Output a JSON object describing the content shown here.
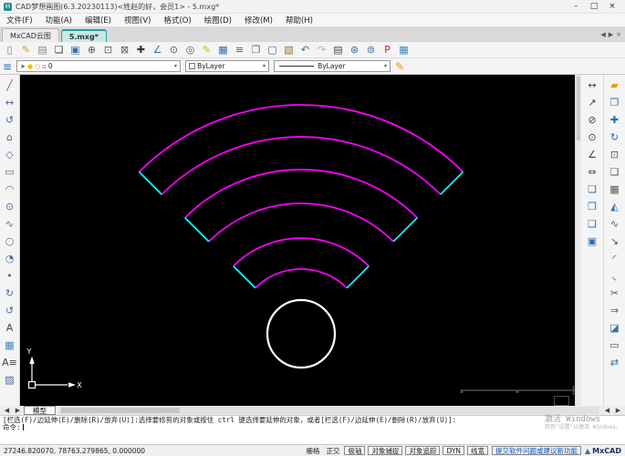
{
  "window": {
    "title": "CAD梦想画图(6.3.20230113)<姓赵的好，会员1> - 5.mxg*",
    "controls": {
      "minimize": "–",
      "maximize": "□",
      "close": "×"
    }
  },
  "menu": {
    "items": [
      "文件(F)",
      "功能(A)",
      "编辑(E)",
      "视图(V)",
      "格式(O)",
      "绘图(D)",
      "修改(M)",
      "帮助(H)"
    ]
  },
  "doc_tabs": {
    "items": [
      {
        "label": "MxCAD云图",
        "name": "tab-mxcad-cloud",
        "active": false
      },
      {
        "label": "5.mxg*",
        "name": "tab-5mxg",
        "active": true
      }
    ],
    "scroll_left": "◀",
    "scroll_right": "▶",
    "close": "×"
  },
  "toolbar_main": {
    "icons": [
      {
        "name": "new-file-icon",
        "glyph": "▯",
        "color": "#7a7a7a"
      },
      {
        "name": "sketch-edit-icon",
        "glyph": "✎",
        "color": "#e09a00"
      },
      {
        "name": "save-sketch-icon",
        "glyph": "▤",
        "color": "#8a8a8a"
      },
      {
        "name": "open-file-icon",
        "glyph": "❏",
        "color": "#4a3b2a"
      },
      {
        "name": "save-file-icon",
        "glyph": "▣",
        "color": "#3a6ea5"
      },
      {
        "name": "zoom-dynamic-icon",
        "glyph": "⊕",
        "color": "#5a5a5a"
      },
      {
        "name": "zoom-window-icon",
        "glyph": "⊡",
        "color": "#5a5a5a"
      },
      {
        "name": "zoom-extents-icon",
        "glyph": "⊠",
        "color": "#5a5a5a"
      },
      {
        "name": "pan-icon",
        "glyph": "✚",
        "color": "#333333"
      },
      {
        "name": "line-angle-icon",
        "glyph": "∠",
        "color": "#3a6ea5"
      },
      {
        "name": "zoom-center-icon",
        "glyph": "⊙",
        "color": "#5a5a5a"
      },
      {
        "name": "find-icon",
        "glyph": "◎",
        "color": "#5a5a5a"
      },
      {
        "name": "draw-pencil-icon",
        "glyph": "✎",
        "color": "#d4b400"
      },
      {
        "name": "color-table-icon",
        "glyph": "▦",
        "color": "#3a6ea5"
      },
      {
        "name": "text-list-icon",
        "glyph": "≡",
        "color": "#6a5a00"
      },
      {
        "name": "copy-page-icon",
        "glyph": "❐",
        "color": "#6a6a6a"
      },
      {
        "name": "screen-display-icon",
        "glyph": "▢",
        "color": "#3a6ea5"
      },
      {
        "name": "save-block-icon",
        "glyph": "▧",
        "color": "#8a7a2a"
      },
      {
        "name": "undo-icon",
        "glyph": "↶",
        "color": "#2a6db5"
      },
      {
        "name": "redo-icon",
        "glyph": "↷",
        "color": "#b0b0b0"
      },
      {
        "name": "print-icon",
        "glyph": "▤",
        "color": "#4a4a4a"
      },
      {
        "name": "web-publish-icon",
        "glyph": "⊛",
        "color": "#2a6db5"
      },
      {
        "name": "web-settings-icon",
        "glyph": "⊜",
        "color": "#2a6db5"
      },
      {
        "name": "pdf-export-icon",
        "glyph": "P",
        "color": "#c42b2b"
      },
      {
        "name": "image-export-icon",
        "glyph": "▦",
        "color": "#3a8ac4"
      }
    ]
  },
  "propsbar": {
    "layer_chips": [
      {
        "name": "layer-flag-icon",
        "glyph": "➤",
        "color": "#555555"
      },
      {
        "name": "layer-on-icon",
        "glyph": "●",
        "color": "#e8c500"
      },
      {
        "name": "layer-freeze-icon",
        "glyph": "○",
        "color": "#d48a00"
      },
      {
        "name": "layer-color-chip",
        "glyph": "▫",
        "color": "#333333"
      }
    ],
    "layer_value": "0",
    "color_value": "ByLayer",
    "linetype_value": "ByLayer",
    "dropdown_arrow": "▾",
    "pencil_glyph": "✎"
  },
  "left_toolbar": {
    "icons": [
      {
        "name": "line-tool-icon",
        "glyph": "╱",
        "color": "#4a6b9a"
      },
      {
        "name": "construction-line-icon",
        "glyph": "↔",
        "color": "#4a6b9a"
      },
      {
        "name": "polyline-icon",
        "glyph": "↺",
        "color": "#4a6b9a"
      },
      {
        "name": "polygon-inscribed-icon",
        "glyph": "⌂",
        "color": "#4a6b9a"
      },
      {
        "name": "polygon-icon",
        "glyph": "◇",
        "color": "#4a6b9a"
      },
      {
        "name": "rectangle-icon",
        "glyph": "▭",
        "color": "#4a6b9a"
      },
      {
        "name": "arc-icon",
        "glyph": "◠",
        "color": "#4a6b9a"
      },
      {
        "name": "circle-icon",
        "glyph": "⊙",
        "color": "#4a6b9a"
      },
      {
        "name": "spline-icon",
        "glyph": "∿",
        "color": "#4a6b9a"
      },
      {
        "name": "ellipse-icon",
        "glyph": "○",
        "color": "#4a6b9a"
      },
      {
        "name": "ellipse-arc-icon",
        "glyph": "◔",
        "color": "#4a6b9a"
      },
      {
        "name": "point-icon",
        "glyph": "•",
        "color": "#4a6b9a"
      },
      {
        "name": "block-insert-icon",
        "glyph": "↻",
        "color": "#4a6b9a"
      },
      {
        "name": "block-create-icon",
        "glyph": "↺",
        "color": "#4a6b9a"
      },
      {
        "name": "text-icon",
        "glyph": "A",
        "color": "#444444"
      },
      {
        "name": "image-insert-icon",
        "glyph": "▦",
        "color": "#3a8ac4"
      },
      {
        "name": "mtext-icon",
        "glyph": "A≡",
        "color": "#444444"
      },
      {
        "name": "hatch-icon",
        "glyph": "▨",
        "color": "#4a6b9a"
      }
    ]
  },
  "dim_toolbar": {
    "icons": [
      {
        "name": "linear-dim-icon",
        "glyph": "↔",
        "color": "#444444"
      },
      {
        "name": "aligned-dim-icon",
        "glyph": "↗",
        "color": "#444444"
      },
      {
        "name": "diameter-dim-icon",
        "glyph": "⊘",
        "color": "#444444"
      },
      {
        "name": "radius-dim-icon",
        "glyph": "⊙",
        "color": "#444444"
      },
      {
        "name": "angular-dim-icon",
        "glyph": "∠",
        "color": "#444444"
      },
      {
        "name": "baseline-dim-icon",
        "glyph": "⇔",
        "color": "#444444"
      },
      {
        "name": "block-tool-1-icon",
        "glyph": "❏",
        "color": "#2a6db5"
      },
      {
        "name": "block-tool-2-icon",
        "glyph": "❐",
        "color": "#2a6db5"
      },
      {
        "name": "block-tool-3-icon",
        "glyph": "❑",
        "color": "#2a6db5"
      },
      {
        "name": "block-tool-4-icon",
        "glyph": "▣",
        "color": "#2a6db5"
      }
    ]
  },
  "modify_toolbar": {
    "icons": [
      {
        "name": "erase-icon",
        "glyph": "▰",
        "color": "#e0a000"
      },
      {
        "name": "copy-icon",
        "glyph": "❐",
        "color": "#2a6db5"
      },
      {
        "name": "move-icon",
        "glyph": "✚",
        "color": "#2a6db5"
      },
      {
        "name": "rotate-icon",
        "glyph": "↻",
        "color": "#2a6db5"
      },
      {
        "name": "scale-icon",
        "glyph": "⊡",
        "color": "#555555"
      },
      {
        "name": "offset-icon",
        "glyph": "❏",
        "color": "#555555"
      },
      {
        "name": "array-icon",
        "glyph": "▦",
        "color": "#555555"
      },
      {
        "name": "mirror-icon",
        "glyph": "◭",
        "color": "#2a6db5"
      },
      {
        "name": "spline-edit-icon",
        "glyph": "∿",
        "color": "#555555"
      },
      {
        "name": "stretch-icon",
        "glyph": "↘",
        "color": "#555555"
      },
      {
        "name": "fillet-icon",
        "glyph": "◜",
        "color": "#555555"
      },
      {
        "name": "chamfer-icon",
        "glyph": "◟",
        "color": "#555555"
      },
      {
        "name": "trim-icon",
        "glyph": "✂",
        "color": "#555555"
      },
      {
        "name": "extend-icon",
        "glyph": "⇒",
        "color": "#555555"
      },
      {
        "name": "explode-icon",
        "glyph": "◪",
        "color": "#3a6ea5"
      },
      {
        "name": "wipeout-icon",
        "glyph": "▭",
        "color": "#555555"
      },
      {
        "name": "join-icon",
        "glyph": "⇄",
        "color": "#2a6db5"
      }
    ]
  },
  "canvas": {
    "colors": {
      "background": "#000000",
      "arc": "#ff00ff",
      "tip": "#00ffff",
      "circle": "#ffffff",
      "ucs": "#ffffff",
      "ghost": "#4d4d4d"
    },
    "ucs": {
      "x_label": "X",
      "y_label": "Y"
    }
  },
  "modelrow": {
    "scroll_left": "◀",
    "scroll_right": "▶",
    "tab_label": "模型"
  },
  "command": {
    "lines": [
      "[栏选(F)/边延伸(E)/删除(R)/放弃(U)]:",
      "选择要修剪的对象或按住 ctrl 键选择要延伸的对象，或者",
      "[栏选(F)/边延伸(E)/删除(R)/放弃(U)]:"
    ],
    "prompt": "命令:"
  },
  "watermark": {
    "line1": "激活 Windows",
    "line2": "转到\"设置\"以激活 Windows。"
  },
  "statusbar": {
    "coordinates": "27246.820070, 78763.279865, 0.000000",
    "toggles": [
      {
        "label": "栅格",
        "name": "toggle-grid",
        "boxed": false
      },
      {
        "label": "正交",
        "name": "toggle-ortho",
        "boxed": false
      },
      {
        "label": "极轴",
        "name": "toggle-polar",
        "boxed": true
      },
      {
        "label": "对象捕捉",
        "name": "toggle-osnap",
        "boxed": true
      },
      {
        "label": "对象追踪",
        "name": "toggle-otrack",
        "boxed": true
      },
      {
        "label": "DYN",
        "name": "toggle-dyn",
        "boxed": true
      },
      {
        "label": "线宽",
        "name": "toggle-lineweight",
        "boxed": true
      }
    ],
    "feedback_link": "提交软件问题或建议新功能",
    "brand": "MxCAD",
    "brand_glyph": "▲"
  }
}
